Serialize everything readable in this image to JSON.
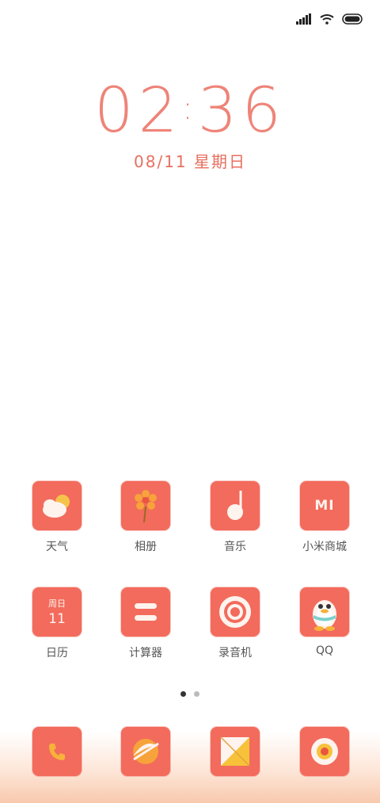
{
  "lock": {
    "time_hh": "02",
    "time_sep": ":",
    "time_mm": "36",
    "date": "08/11 星期日"
  },
  "status": {
    "signal_icon": "signal-icon",
    "wifi_icon": "wifi-icon",
    "battery_icon": "battery-icon"
  },
  "row1": [
    {
      "label": "天气",
      "icon": "weather-icon"
    },
    {
      "label": "相册",
      "icon": "gallery-icon"
    },
    {
      "label": "音乐",
      "icon": "music-icon"
    },
    {
      "label": "小米商城",
      "icon": "mi-store-icon"
    }
  ],
  "row2": [
    {
      "label": "日历",
      "icon": "calendar-icon",
      "cal_header": "周日",
      "cal_day": "11"
    },
    {
      "label": "计算器",
      "icon": "calculator-icon"
    },
    {
      "label": "录音机",
      "icon": "recorder-icon"
    },
    {
      "label": "QQ",
      "icon": "qq-icon"
    }
  ],
  "dock": [
    {
      "icon": "phone-icon"
    },
    {
      "icon": "browser-icon"
    },
    {
      "icon": "messages-icon"
    },
    {
      "icon": "camera-icon"
    }
  ],
  "mi_logo": "MI",
  "pager": {
    "current": 1,
    "total": 2
  },
  "colors": {
    "accent": "#f26b5c",
    "clock": "#ee8478",
    "date": "#e76f5f"
  }
}
